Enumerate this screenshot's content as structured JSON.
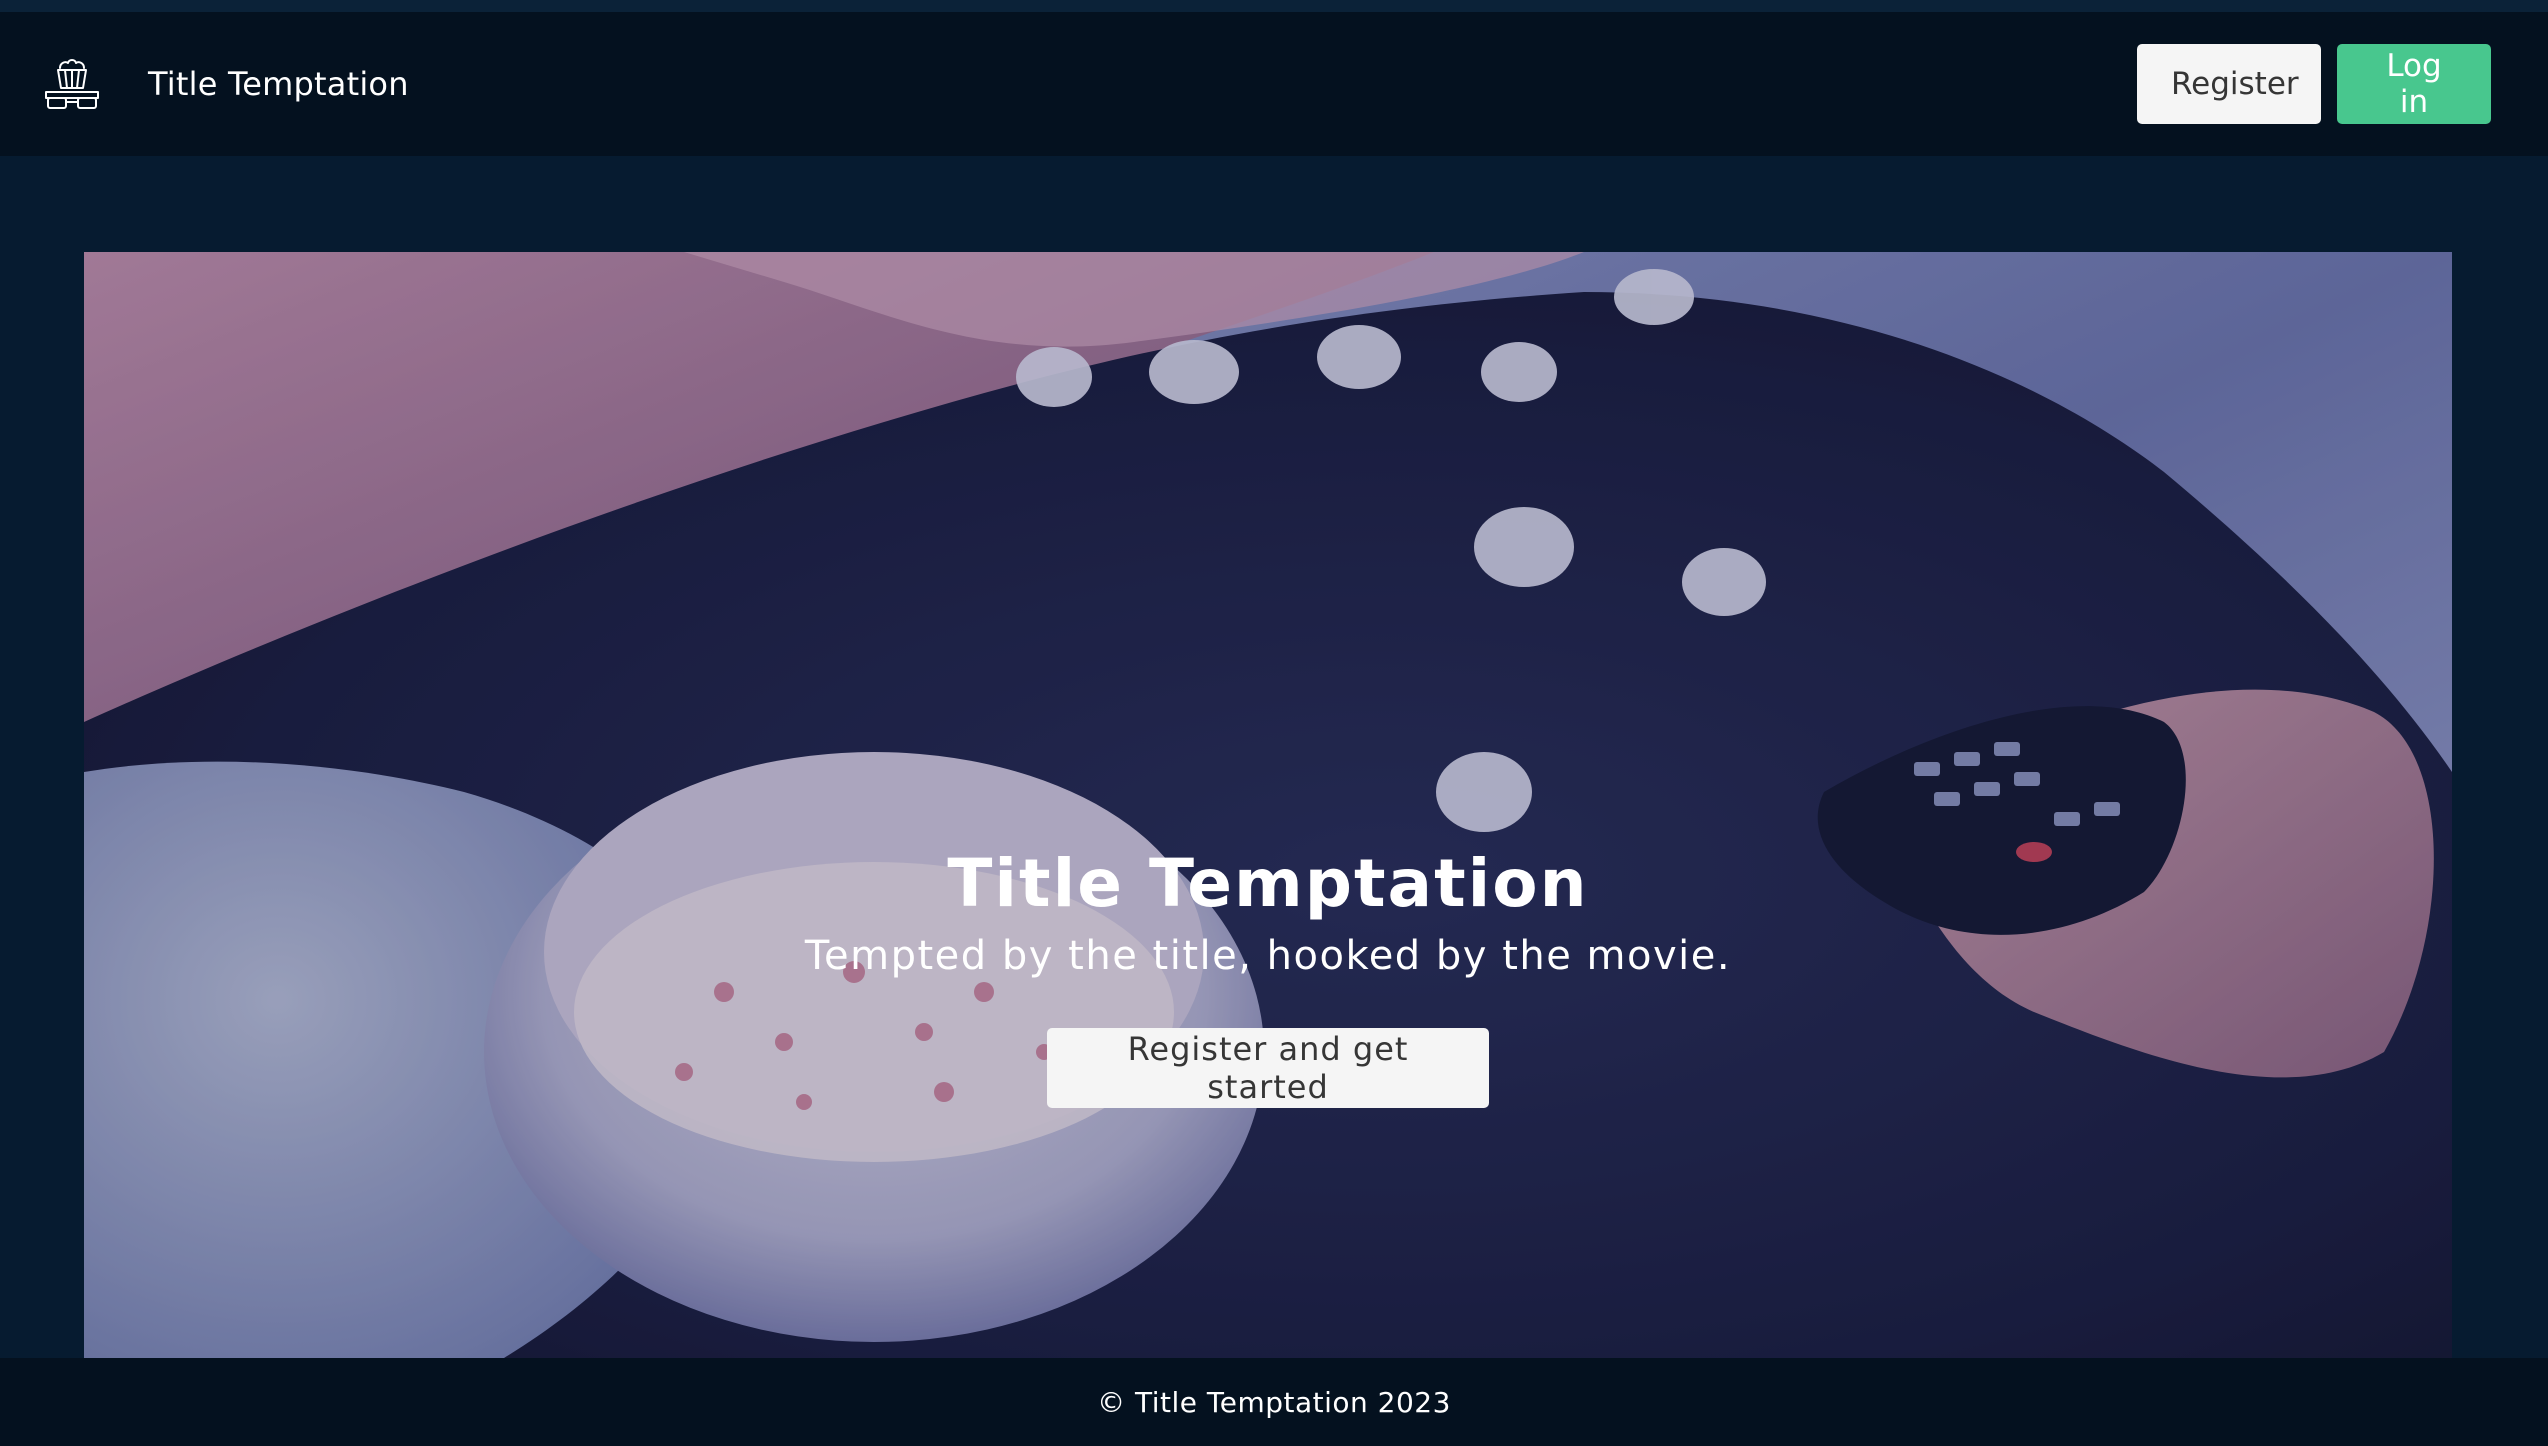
{
  "app": {
    "brand_name": "Title Temptation",
    "logo_icon": "popcorn-3d-glasses-icon"
  },
  "navbar": {
    "register_label": "Register",
    "login_label": "Log in"
  },
  "hero": {
    "title": "Title Temptation",
    "subtitle": "Tempted by the title, hooked by the movie.",
    "cta_label": "Register and get started",
    "background_image": "person-lying-with-popcorn-bowl-and-tv-remote"
  },
  "footer": {
    "copyright": "© Title Temptation 2023"
  },
  "colors": {
    "page_background": "#061b30",
    "navbar_background": "#04111f",
    "login_button": "#48c78e",
    "light_button": "#f5f5f5",
    "button_text_dark": "#363636"
  }
}
